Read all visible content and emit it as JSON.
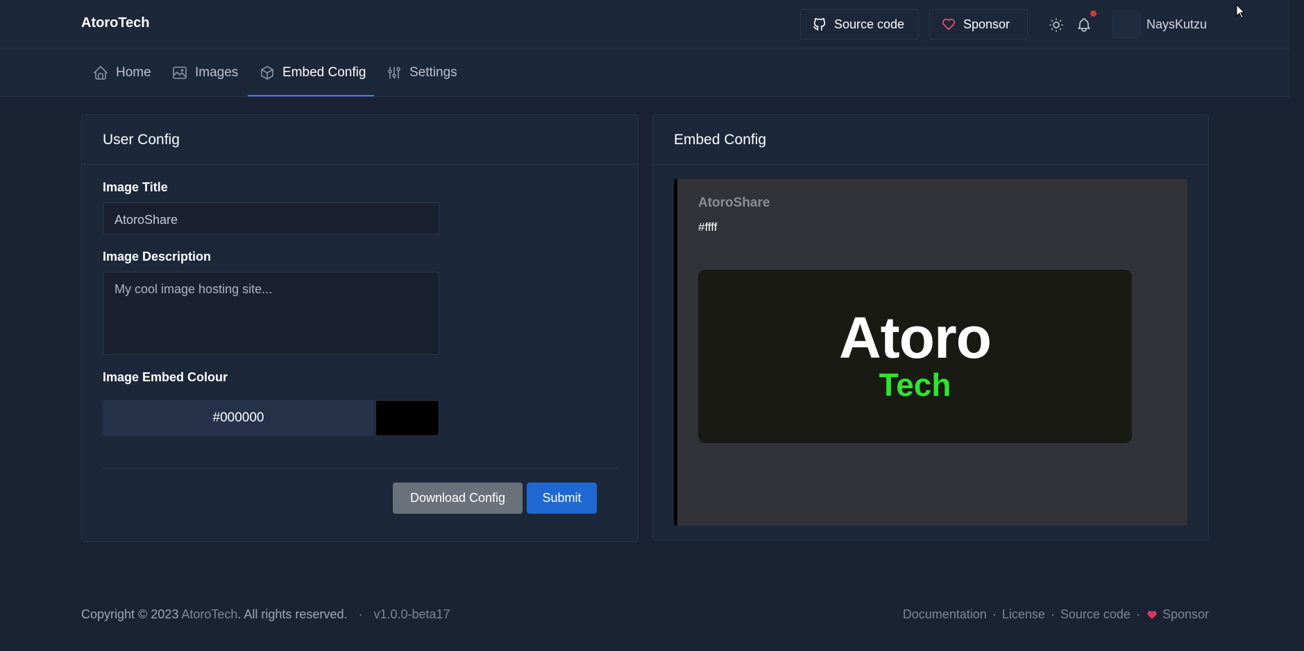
{
  "header": {
    "brand": "AtoroTech",
    "source_code_label": "Source code",
    "sponsor_label": "Sponsor",
    "username": "NaysKutzu"
  },
  "nav": {
    "tabs": [
      {
        "label": "Home",
        "icon": "home-icon"
      },
      {
        "label": "Images",
        "icon": "image-icon"
      },
      {
        "label": "Embed Config",
        "icon": "cube-icon",
        "active": true
      },
      {
        "label": "Settings",
        "icon": "sliders-icon"
      }
    ]
  },
  "user_config": {
    "title": "User Config",
    "image_title_label": "Image Title",
    "image_title_value": "AtoroShare",
    "image_description_label": "Image Description",
    "image_description_placeholder": "My cool image hosting site...",
    "embed_colour_label": "Image Embed Colour",
    "embed_colour_value": "#000000",
    "download_label": "Download Config",
    "submit_label": "Submit"
  },
  "embed_config": {
    "title": "Embed Config",
    "preview_title": "AtoroShare",
    "preview_description": "#ffff",
    "logo_line1": "Atoro",
    "logo_line2": "Tech",
    "accent_color": "#000000"
  },
  "footer": {
    "copyright_prefix": "Copyright © 2023",
    "copyright_brand": "AtoroTech",
    "copyright_suffix": ". All rights reserved.",
    "version": "v1.0.0-beta17",
    "links": [
      "Documentation",
      "License",
      "Source code",
      "Sponsor"
    ]
  }
}
